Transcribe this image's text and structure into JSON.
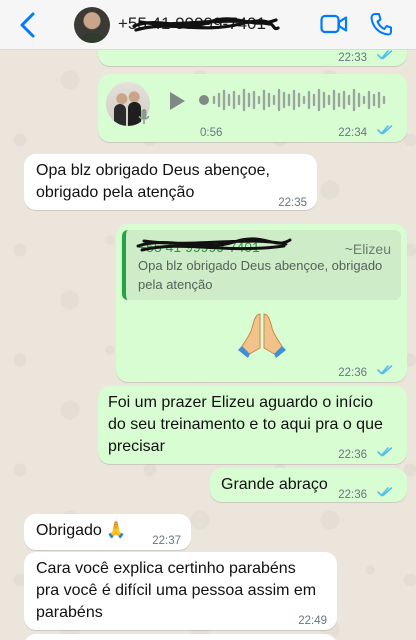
{
  "header": {
    "contact_name": "+55 41 99999-7401",
    "icons": [
      "back-chevron-icon",
      "contact-avatar",
      "video-call-icon",
      "phone-call-icon"
    ],
    "accent_color": "#007aff"
  },
  "messages": {
    "top_fragment": {
      "time": "22:33",
      "status": "read"
    },
    "voice": {
      "duration": "0:56",
      "time": "22:34",
      "status": "read"
    },
    "m1": {
      "text": "Opa blz obrigado Deus abençoe, obrigado pela atenção",
      "time": "22:35"
    },
    "m2": {
      "quote_sender": "+55 41 99999-7401",
      "quote_tag": "~Elizeu",
      "quote_text": "Opa blz obrigado Deus abençoe, obrigado pela atenção",
      "emoji": "folded-hands",
      "time": "22:36",
      "status": "read"
    },
    "m3": {
      "text": "Foi um prazer Elizeu aguardo o início do seu treinamento e to aqui pra o que precisar",
      "time": "22:36",
      "status": "read"
    },
    "m4": {
      "text": "Grande abraço",
      "time": "22:36",
      "status": "read"
    },
    "m5": {
      "text": "Obrigado 🙏",
      "time": "22:37"
    },
    "m6": {
      "text": "Cara você explica certinho parabéns pra você é difícil uma pessoa assim em parabéns",
      "time": "22:49"
    }
  },
  "colors": {
    "outgoing_bubble": "#d9fdd3",
    "incoming_bubble": "#ffffff",
    "read_ticks": "#53bdeb"
  }
}
